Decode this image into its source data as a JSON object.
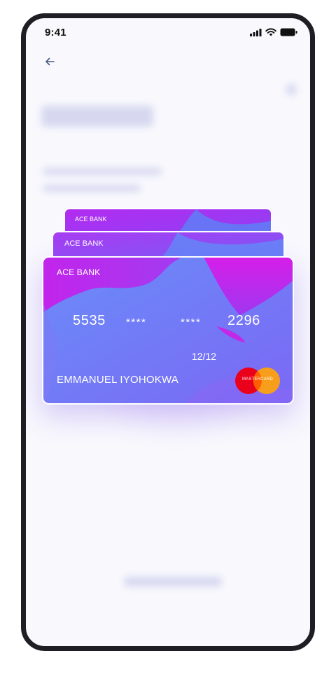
{
  "status_bar": {
    "time": "9:41",
    "icons": [
      "signal-icon",
      "wifi-icon",
      "battery-icon"
    ]
  },
  "navigation": {
    "back_icon": "arrow-left-icon"
  },
  "cards": [
    {
      "bank": "ACE BANK"
    },
    {
      "bank": "ACE BANK"
    },
    {
      "bank": "ACE BANK",
      "number_groups": [
        "5535",
        "****",
        "****",
        "2296"
      ],
      "expiry": "12/12",
      "holder": "EMMANUEL IYOHOKWA",
      "network": "MASTERCARD"
    }
  ],
  "colors": {
    "card_pink": "#c22cf0",
    "card_blue": "#5f8bf7",
    "accent_purple": "#7b5cff",
    "mastercard_red": "#eb001b",
    "mastercard_orange": "#f79e1b",
    "frame": "#1e1e24",
    "background": "#f8f8fd"
  }
}
